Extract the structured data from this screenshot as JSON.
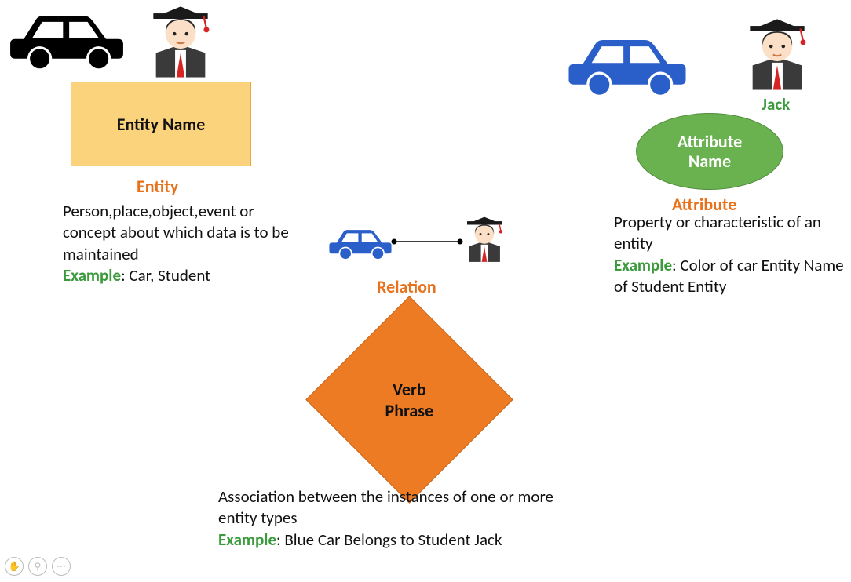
{
  "entity": {
    "box_label": "Entity Name",
    "heading": "Entity",
    "description": "Person,place,object,event or concept about which data is to be maintained",
    "example_prefix": "Example",
    "example_text": ": Car, Student"
  },
  "relation": {
    "diamond_label": "Verb Phrase",
    "heading": "Relation",
    "description": "Association between the instances of one or more entity types",
    "example_prefix": "Example",
    "example_text": ": Blue Car Belongs to Student Jack"
  },
  "attribute": {
    "ellipse_label": "Attribute Name",
    "heading": "Attribute",
    "jack_label": "Jack",
    "description": "Property or characteristic of an entity",
    "example_prefix": "Example",
    "example_text": ": Color of car Entity Name of Student Entity"
  },
  "toolbar": {
    "hand": "✋",
    "zoom": "⚲",
    "more": "⋯"
  }
}
